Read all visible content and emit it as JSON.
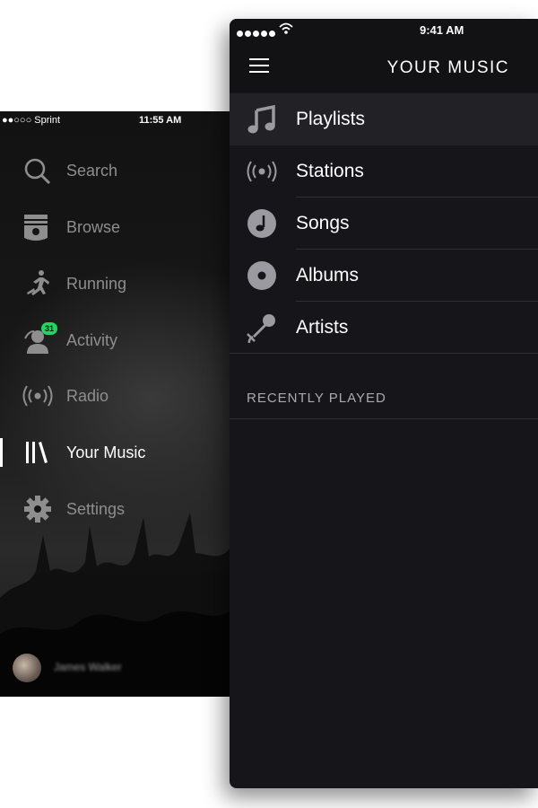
{
  "side_menu": {
    "status": {
      "carrier": "●●○○○ Sprint",
      "time": "11:55 AM"
    },
    "items": [
      {
        "label": "Search",
        "icon": "search-icon"
      },
      {
        "label": "Browse",
        "icon": "browse-icon"
      },
      {
        "label": "Running",
        "icon": "running-icon"
      },
      {
        "label": "Activity",
        "icon": "activity-icon",
        "badge": "31"
      },
      {
        "label": "Radio",
        "icon": "radio-icon"
      },
      {
        "label": "Your Music",
        "icon": "library-icon",
        "active": true
      },
      {
        "label": "Settings",
        "icon": "gear-icon"
      }
    ],
    "profile": {
      "name": "James Walker"
    }
  },
  "main": {
    "status": {
      "time": "9:41 AM"
    },
    "title": "YOUR MUSIC",
    "items": [
      {
        "label": "Playlists",
        "icon": "music-note-icon",
        "selected": true
      },
      {
        "label": "Stations",
        "icon": "radio-icon"
      },
      {
        "label": "Songs",
        "icon": "song-icon"
      },
      {
        "label": "Albums",
        "icon": "album-icon"
      },
      {
        "label": "Artists",
        "icon": "microphone-icon"
      }
    ],
    "section_title": "RECENTLY PLAYED"
  },
  "colors": {
    "accent_green": "#1ed760",
    "background": "#16161a",
    "selected_row": "#212126"
  }
}
